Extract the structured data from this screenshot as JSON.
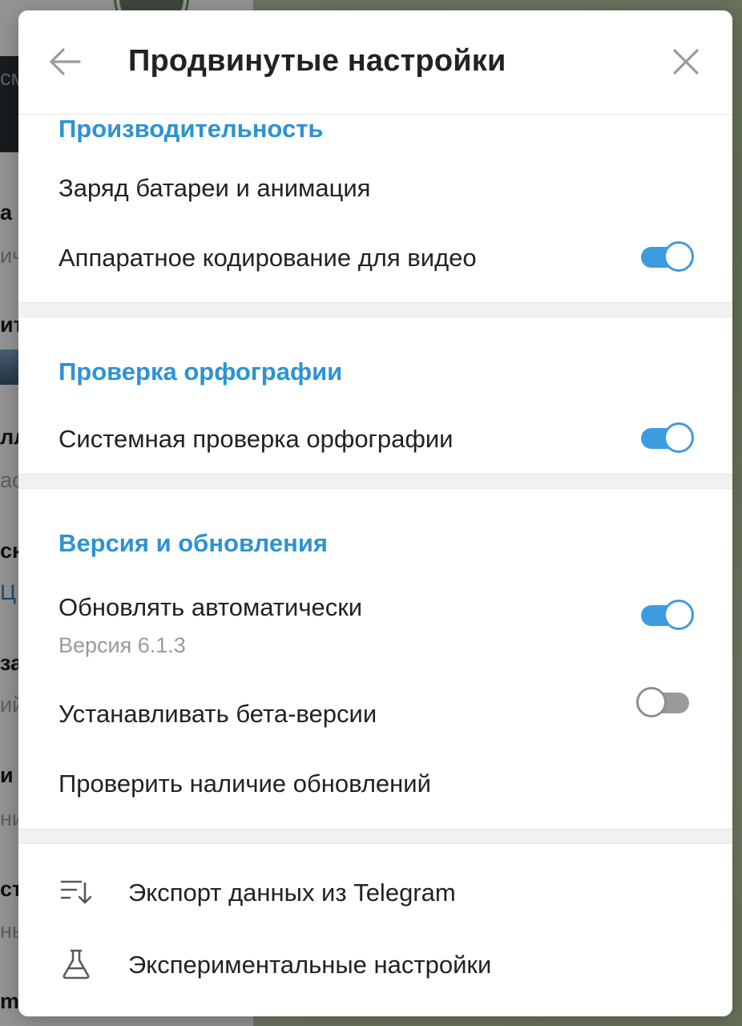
{
  "background": {
    "letters": [
      {
        "text": "см",
        "style": "sub"
      },
      {
        "text": "а",
        "style": "normal"
      },
      {
        "text": "ич",
        "style": "sub"
      },
      {
        "text": "ит",
        "style": "normal"
      },
      {
        "text": "лл",
        "style": "normal"
      },
      {
        "text": "ас",
        "style": "sub"
      },
      {
        "text": "ск",
        "style": "normal"
      },
      {
        "text": "Ц",
        "style": "blue"
      },
      {
        "text": "за",
        "style": "normal"
      },
      {
        "text": "ий",
        "style": "sub"
      },
      {
        "text": "и «",
        "style": "normal"
      },
      {
        "text": "ни",
        "style": "sub"
      },
      {
        "text": "ст",
        "style": "normal"
      },
      {
        "text": "ны",
        "style": "sub"
      },
      {
        "text": "mc",
        "style": "normal"
      }
    ]
  },
  "modal": {
    "title": "Продвинутые настройки",
    "accent_color": "#2d93d2"
  },
  "sections": {
    "performance": {
      "title": "Производительность",
      "items": [
        {
          "label": "Заряд батареи и анимация"
        },
        {
          "label": "Аппаратное кодирование для видео",
          "toggle": true
        }
      ]
    },
    "spellcheck": {
      "title": "Проверка орфографии",
      "items": [
        {
          "label": "Системная проверка орфографии",
          "toggle": true
        }
      ]
    },
    "updates": {
      "title": "Версия и обновления",
      "items": [
        {
          "label": "Обновлять автоматически",
          "sublabel": "Версия 6.1.3",
          "toggle": true
        },
        {
          "label": "Устанавливать бета-версии",
          "toggle": false
        },
        {
          "label": "Проверить наличие обновлений"
        }
      ]
    },
    "misc": {
      "items": [
        {
          "label": "Экспорт данных из Telegram",
          "icon": "export-data-icon"
        },
        {
          "label": "Экспериментальные настройки",
          "icon": "flask-icon"
        }
      ]
    }
  }
}
